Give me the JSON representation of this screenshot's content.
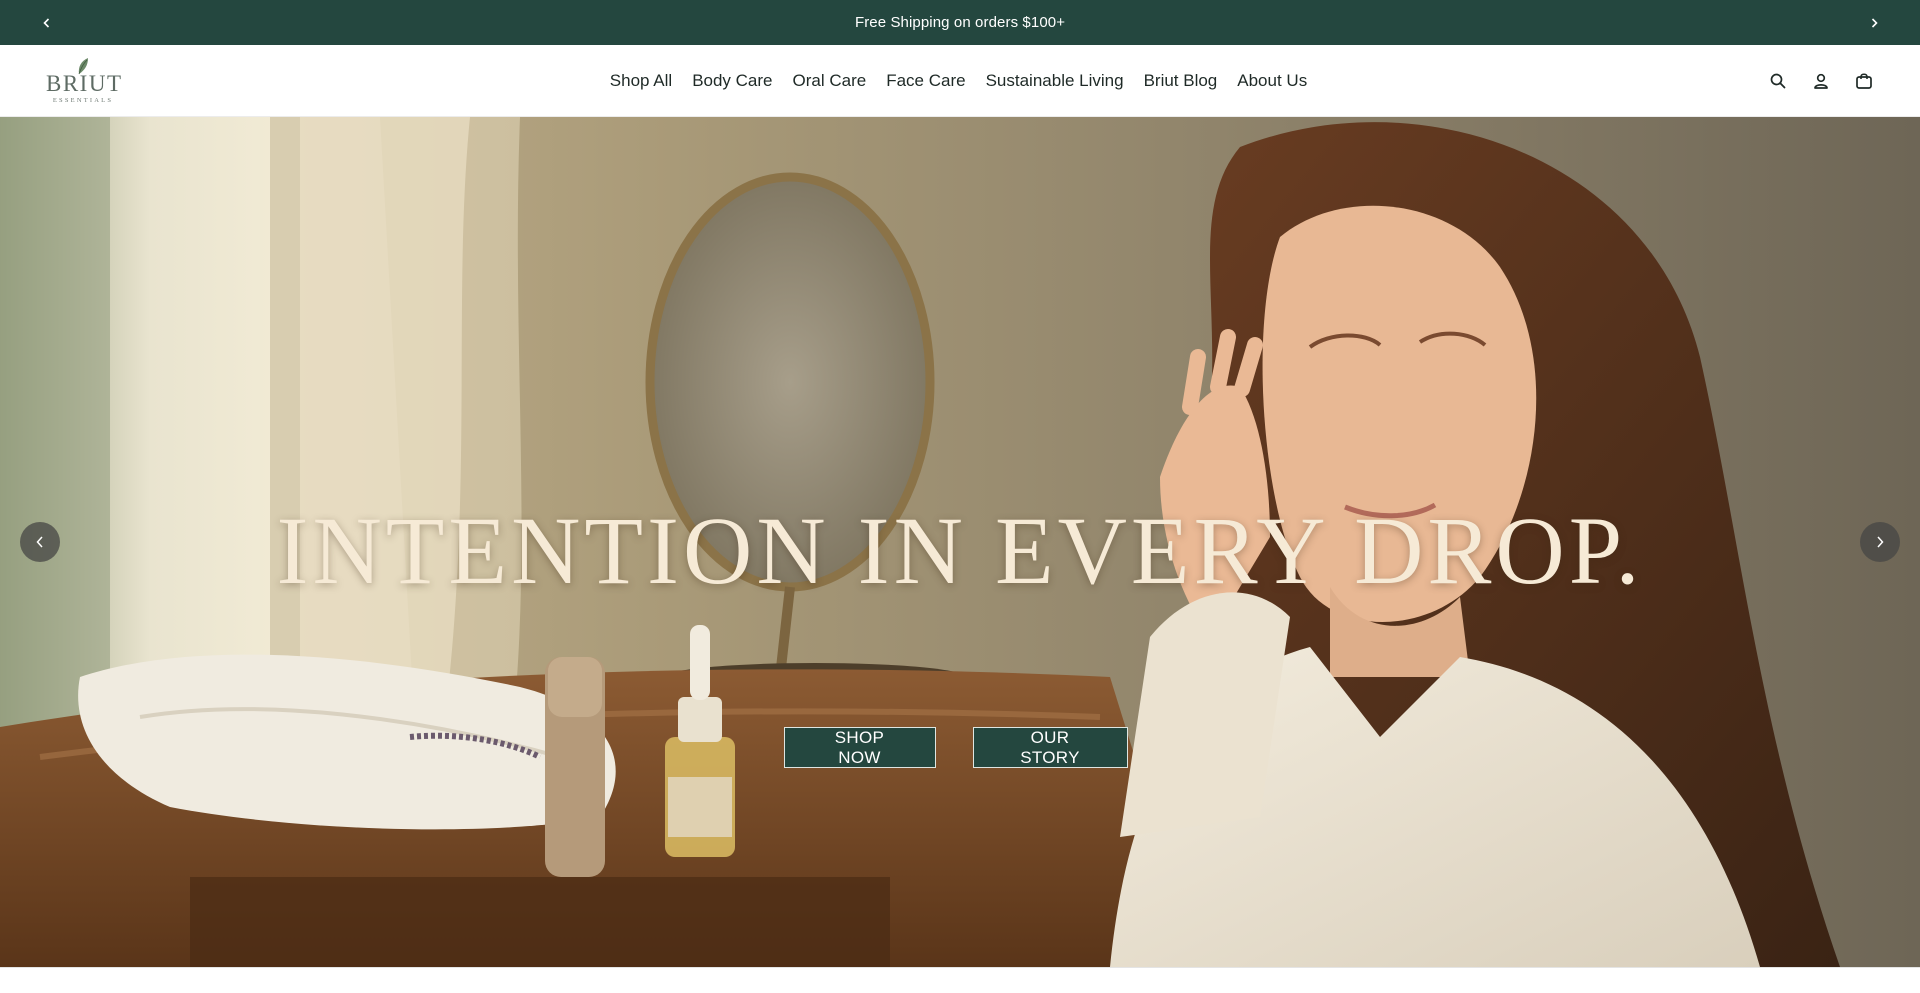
{
  "announcement": {
    "text": "Free Shipping on orders $100+",
    "prev_icon": "chevron-left-icon",
    "next_icon": "chevron-right-icon"
  },
  "header": {
    "logo": {
      "wordmark": "BRIUT",
      "subtitle": "ESSENTIALS"
    },
    "nav": [
      {
        "label": "Shop All"
      },
      {
        "label": "Body Care"
      },
      {
        "label": "Oral Care"
      },
      {
        "label": "Face Care"
      },
      {
        "label": "Sustainable Living"
      },
      {
        "label": "Briut Blog"
      },
      {
        "label": "About Us"
      }
    ],
    "icons": [
      "search-icon",
      "account-icon",
      "cart-icon"
    ]
  },
  "hero": {
    "title": "INTENTION IN EVERY DROP.",
    "primary_button": "SHOP NOW",
    "secondary_button": "OUR STORY",
    "prev_icon": "chevron-left-icon",
    "next_icon": "chevron-right-icon"
  },
  "colors": {
    "brand_green": "#24473f",
    "hero_title": "#f6ead6",
    "logo_gray": "#5e6b64"
  }
}
